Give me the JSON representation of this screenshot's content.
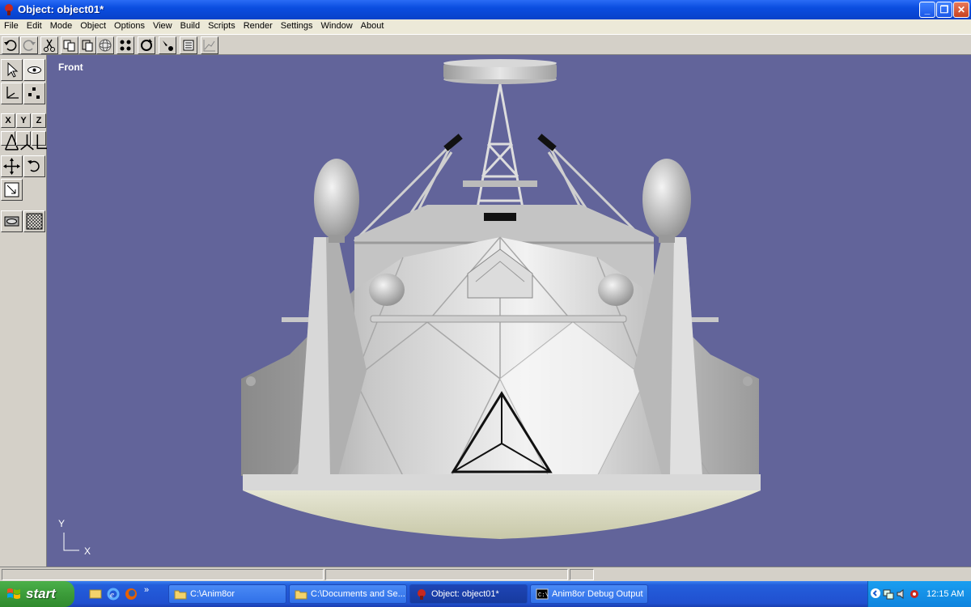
{
  "window": {
    "title": "Object: object01*",
    "minimize": "_",
    "maximize": "❐",
    "close": "✕"
  },
  "menu": [
    "File",
    "Edit",
    "Mode",
    "Object",
    "Options",
    "View",
    "Build",
    "Scripts",
    "Render",
    "Settings",
    "Window",
    "About"
  ],
  "toolbar": {
    "icons": [
      "undo-icon",
      "redo-icon",
      "cut-icon",
      "copy-icon",
      "paste-icon",
      "sphere-icon",
      "points-icon",
      "rotate-view-icon",
      "add-point-icon",
      "list-icon",
      "graph-icon"
    ]
  },
  "left_panel": {
    "axis_buttons": [
      "X",
      "Y",
      "Z"
    ]
  },
  "viewport": {
    "label": "Front",
    "axis_y": "Y",
    "axis_x": "X",
    "background": "#62649a"
  },
  "taskbar": {
    "start": "start",
    "tasks": [
      {
        "label": "C:\\Anim8or",
        "icon": "folder-icon"
      },
      {
        "label": "C:\\Documents and Se...",
        "icon": "folder-icon"
      },
      {
        "label": "Object: object01*",
        "icon": "anim8or-icon"
      },
      {
        "label": "Anim8or Debug Output",
        "icon": "console-icon"
      }
    ],
    "clock": "12:15 AM"
  }
}
